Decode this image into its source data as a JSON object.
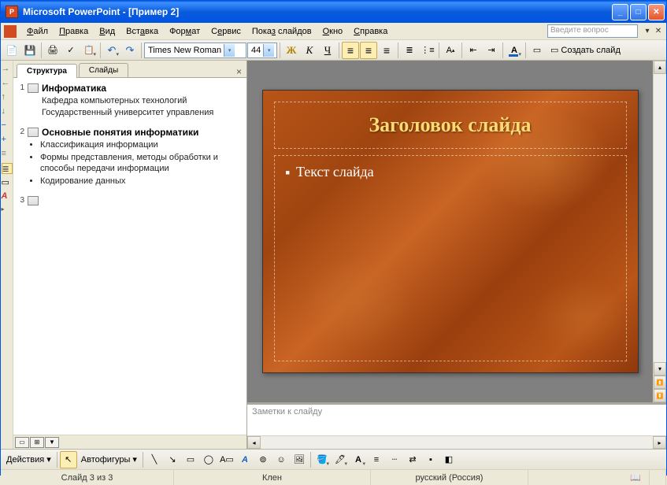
{
  "title": "Microsoft PowerPoint - [Пример 2]",
  "menu": [
    "Файл",
    "Правка",
    "Вид",
    "Вставка",
    "Формат",
    "Сервис",
    "Показ слайдов",
    "Окно",
    "Справка"
  ],
  "help_placeholder": "Введите вопрос",
  "font": {
    "name": "Times New Roman",
    "size": "44"
  },
  "new_slide_label": "Создать слайд",
  "tabs": {
    "outline": "Структура",
    "slides": "Слайды"
  },
  "outline": [
    {
      "num": "1",
      "title": "Информатика",
      "body": "Кафедра компьютерных технологий\nГосударственный университет управления"
    },
    {
      "num": "2",
      "title": "Основные понятия информатики",
      "bullets": [
        "Классификация информации",
        "Формы представления, методы обработки и способы передачи информации",
        "Кодирование данных"
      ]
    },
    {
      "num": "3",
      "title": ""
    }
  ],
  "slide": {
    "title": "Заголовок слайда",
    "body": "Текст слайда"
  },
  "notes_placeholder": "Заметки к слайду",
  "drawbar": {
    "actions": "Действия",
    "autoshapes": "Автофигуры"
  },
  "status": {
    "slide": "Слайд 3 из 3",
    "theme": "Клен",
    "lang": "русский (Россия)"
  }
}
